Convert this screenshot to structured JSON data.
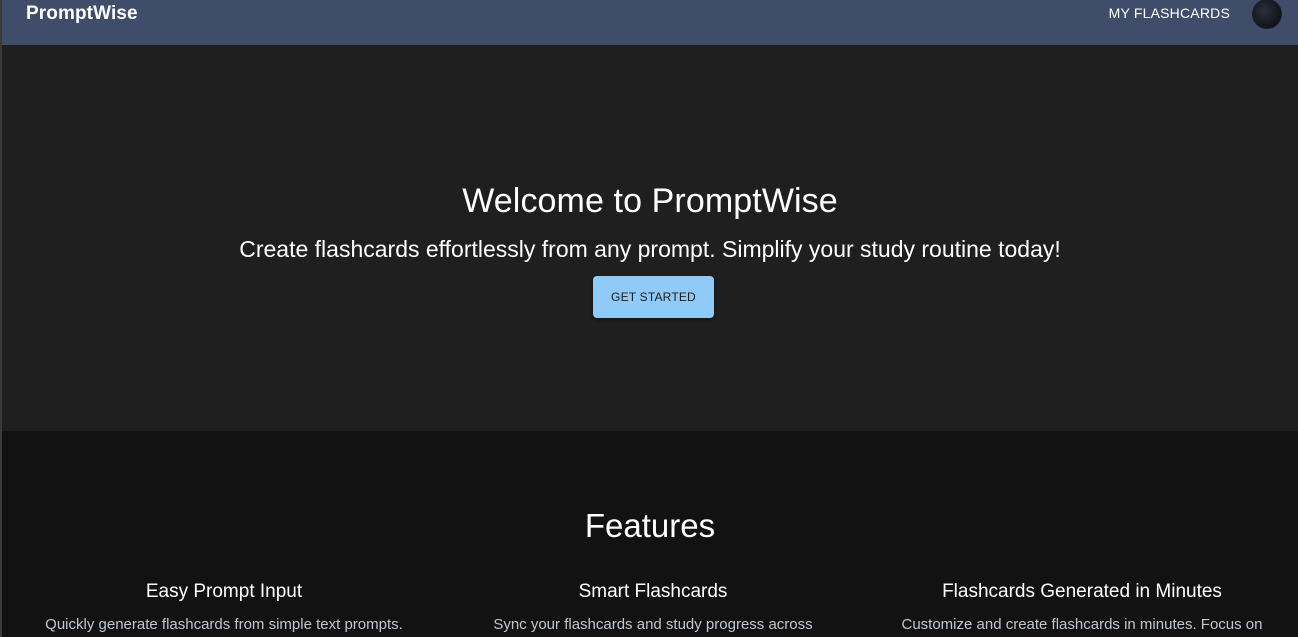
{
  "header": {
    "brand": "PromptWise",
    "nav_link": "MY FLASHCARDS",
    "avatar_icon": "user-avatar-icon"
  },
  "hero": {
    "title": "Welcome to PromptWise",
    "subtitle": "Create flashcards effortlessly from any prompt. Simplify your study routine today!",
    "cta": "GET STARTED"
  },
  "features": {
    "title": "Features",
    "items": [
      {
        "title": "Easy Prompt Input",
        "description": "Quickly generate flashcards from simple text prompts."
      },
      {
        "title": "Smart Flashcards",
        "description": "Sync your flashcards and study progress across"
      },
      {
        "title": "Flashcards Generated in Minutes",
        "description": "Customize and create flashcards in minutes. Focus on"
      }
    ]
  },
  "colors": {
    "header_bg": "#3f4d6a",
    "hero_bg": "#1f1f1f",
    "features_bg": "#121212",
    "cta_bg": "#90caf9"
  }
}
